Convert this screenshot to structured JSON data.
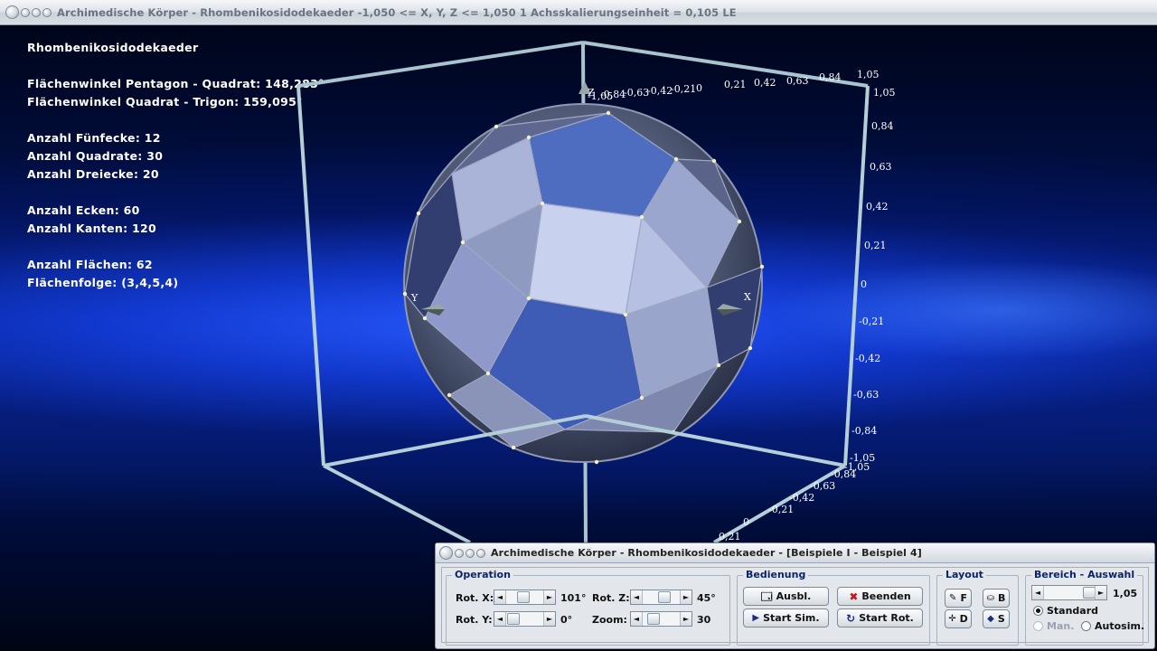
{
  "window": {
    "title": "Archimedische Körper - Rhombenikosidodekaeder   -1,050 <= X, Y, Z <= 1,050    1 Achsskalierungseinheit = 0,105 LE"
  },
  "info": {
    "name": "Rhombenikosidodekaeder",
    "angle_pentagon_square": "Flächenwinkel Pentagon - Quadrat: 148,283°",
    "angle_square_trigon": "Flächenwinkel Quadrat - Trigon: 159,095°",
    "pentagons": "Anzahl Fünfecke: 12",
    "squares": "Anzahl Quadrate: 30",
    "triangles": "Anzahl Dreiecke: 20",
    "vertices": "Anzahl Ecken: 60",
    "edges": "Anzahl Kanten: 120",
    "faces": "Anzahl Flächen: 62",
    "face_sequence": "Flächenfolge: (3,4,5,4)"
  },
  "axes": {
    "x_label": "X",
    "y_label": "Y",
    "z_label": "Z",
    "ticks_right": [
      "1,05",
      "0,84",
      "0,63",
      "0,42",
      "0,21",
      "0",
      "-0,21",
      "-0,42",
      "-0,63",
      "-0,84",
      "-1,05"
    ],
    "ticks_top": [
      "-0,84",
      "-0,63",
      "-0,42",
      "-0,21",
      "0",
      "0,21",
      "0,42",
      "0,63",
      "0,84",
      "1,05"
    ],
    "ticks_top_prefix": "-1,05",
    "ticks_bottom": [
      "-1,05",
      "-0,84",
      "-0,63",
      "-0,42",
      "-0,21",
      "0",
      "0,21"
    ]
  },
  "dialog": {
    "title": "Archimedische Körper - Rhombenikosidodekaeder - [Beispiele I - Beispiel 4]",
    "operation": {
      "title": "Operation",
      "rot_x_label": "Rot. X:",
      "rot_x_value": "101°",
      "rot_y_label": "Rot. Y:",
      "rot_y_value": "0°",
      "rot_z_label": "Rot. Z:",
      "rot_z_value": "45°",
      "zoom_label": "Zoom:",
      "zoom_value": "30"
    },
    "bedienung": {
      "title": "Bedienung",
      "ausbl": "Ausbl.",
      "beenden": "Beenden",
      "start_sim": "Start Sim.",
      "start_rot": "Start Rot."
    },
    "layout": {
      "title": "Layout",
      "f": "F",
      "b": "B",
      "d": "D",
      "s": "S"
    },
    "bereich": {
      "title": "Bereich - Auswahl",
      "value": "1,05",
      "standard": "Standard",
      "man": "Man.",
      "autosim": "Autosim."
    }
  }
}
